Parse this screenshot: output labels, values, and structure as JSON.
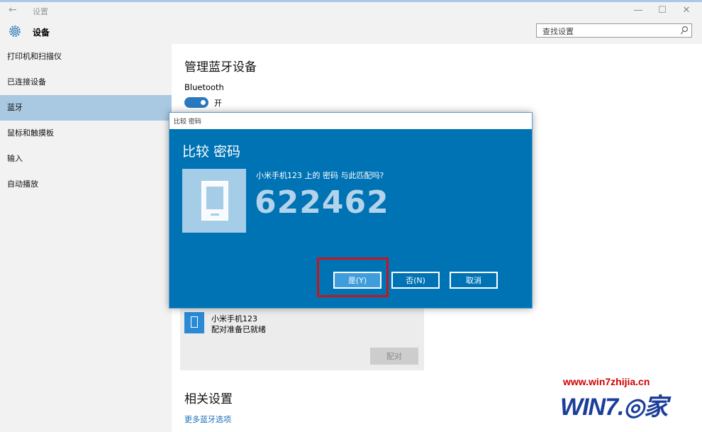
{
  "window": {
    "back_glyph": "←",
    "title": "设置",
    "minimize_glyph": "—",
    "maximize_glyph": "☐",
    "close_glyph": "✕"
  },
  "header": {
    "icon": "gear-icon",
    "title": "设备",
    "search_placeholder": "查找设置",
    "search_icon": "search-icon"
  },
  "sidebar": {
    "items": [
      {
        "label": "打印机和扫描仪",
        "active": false
      },
      {
        "label": "已连接设备",
        "active": false
      },
      {
        "label": "蓝牙",
        "active": true
      },
      {
        "label": "鼠标和触摸板",
        "active": false
      },
      {
        "label": "输入",
        "active": false
      },
      {
        "label": "自动播放",
        "active": false
      }
    ]
  },
  "main": {
    "heading": "管理蓝牙设备",
    "bluetooth_label": "Bluetooth",
    "toggle_state": "开",
    "device": {
      "icon": "phone-icon",
      "name": "小米手机123",
      "status": "配对准备已就绪",
      "pair_label": "配对"
    },
    "related_heading": "相关设置",
    "more_link": "更多蓝牙选项"
  },
  "dialog": {
    "titlebar": "比较 密码",
    "heading": "比较 密码",
    "question": "小米手机123 上的 密码 与此匹配吗?",
    "code": "622462",
    "yes_label": "是(Y)",
    "no_label": "否(N)",
    "cancel_label": "取消"
  },
  "watermark": {
    "url": "www.win7zhijia.cn",
    "logo": "WIN7.◎家"
  },
  "colors": {
    "accent": "#0073b5",
    "sidebar_active": "#a9c9e2",
    "highlight": "#c5161c",
    "link": "#1a6fb8"
  }
}
